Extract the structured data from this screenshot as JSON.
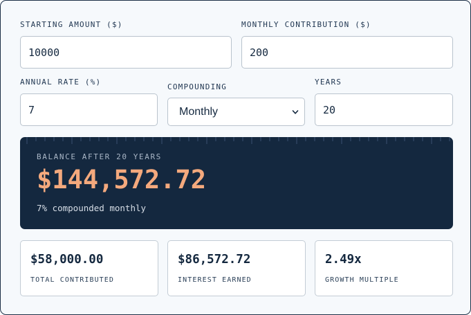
{
  "inputs": {
    "starting_amount": {
      "label": "STARTING AMOUNT ($)",
      "value": "10000"
    },
    "monthly_contribution": {
      "label": "MONTHLY CONTRIBUTION ($)",
      "value": "200"
    },
    "annual_rate": {
      "label": "ANNUAL RATE (%)",
      "value": "7"
    },
    "compounding": {
      "label": "COMPOUNDING",
      "selected": "Monthly"
    },
    "years": {
      "label": "YEARS",
      "value": "20"
    }
  },
  "result": {
    "label": "BALANCE AFTER 20 YEARS",
    "balance": "$144,572.72",
    "note": "7% compounded monthly"
  },
  "stats": [
    {
      "value": "$58,000.00",
      "label": "TOTAL CONTRIBUTED"
    },
    {
      "value": "$86,572.72",
      "label": "INTEREST EARNED"
    },
    {
      "value": "2.49x",
      "label": "GROWTH MULTIPLE"
    }
  ],
  "colors": {
    "panel": "#14283f",
    "accent": "#f4a97d",
    "border": "#b9c3cd",
    "background": "#f6f9fc"
  },
  "icons": {
    "select_arrow": "chevron-down-icon"
  }
}
